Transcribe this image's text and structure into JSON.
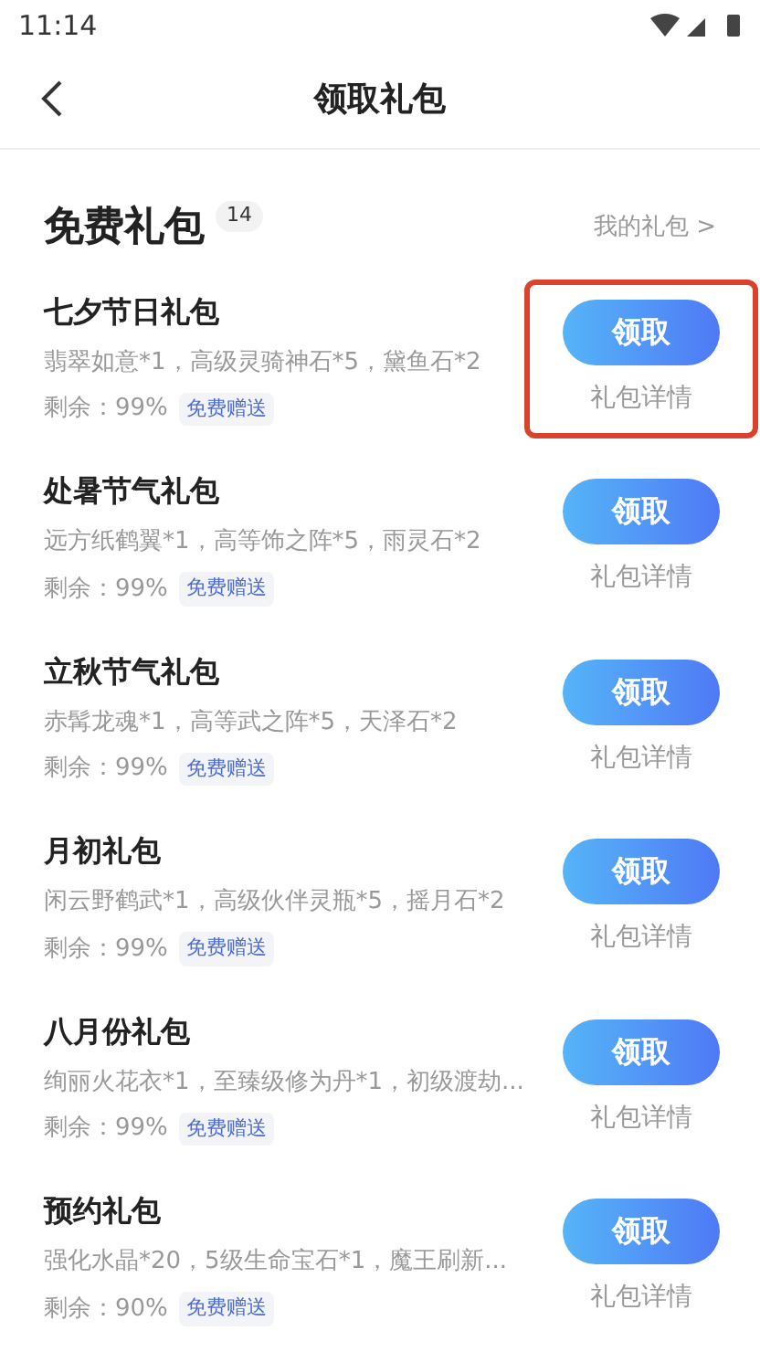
{
  "status_bar": {
    "time": "11:14"
  },
  "header": {
    "title": "领取礼包"
  },
  "section": {
    "title": "免费礼包",
    "count": "14",
    "link": "我的礼包 >"
  },
  "gifts": [
    {
      "name": "七夕节日礼包",
      "contents": "翡翠如意*1，高级灵骑神石*5，黛鱼石*2",
      "remaining": "剩余：99%",
      "tag": "免费赠送",
      "button": "领取",
      "details": "礼包详情",
      "highlighted": true
    },
    {
      "name": "处暑节气礼包",
      "contents": "远方纸鹤翼*1，高等饰之阵*5，雨灵石*2",
      "remaining": "剩余：99%",
      "tag": "免费赠送",
      "button": "领取",
      "details": "礼包详情",
      "highlighted": false
    },
    {
      "name": "立秋节气礼包",
      "contents": "赤髯龙魂*1，高等武之阵*5，天泽石*2",
      "remaining": "剩余：99%",
      "tag": "免费赠送",
      "button": "领取",
      "details": "礼包详情",
      "highlighted": false
    },
    {
      "name": "月初礼包",
      "contents": "闲云野鹤武*1，高级伙伴灵瓶*5，摇月石*2",
      "remaining": "剩余：99%",
      "tag": "免费赠送",
      "button": "领取",
      "details": "礼包详情",
      "highlighted": false
    },
    {
      "name": "八月份礼包",
      "contents": "绚丽火花衣*1，至臻级修为丹*1，初级渡劫...",
      "remaining": "剩余：99%",
      "tag": "免费赠送",
      "button": "领取",
      "details": "礼包详情",
      "highlighted": false
    },
    {
      "name": "预约礼包",
      "contents": "强化水晶*20，5级生命宝石*1，魔王刷新...",
      "remaining": "剩余：90%",
      "tag": "免费赠送",
      "button": "领取",
      "details": "礼包详情",
      "highlighted": false
    }
  ]
}
